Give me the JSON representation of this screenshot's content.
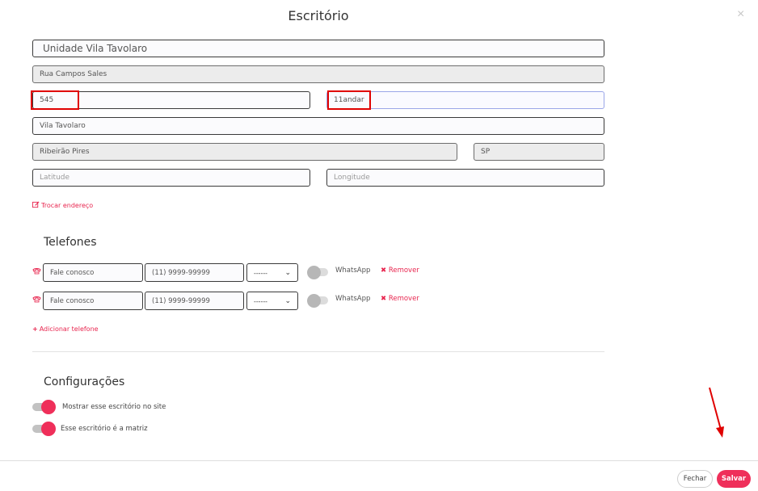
{
  "modal": {
    "title": "Escritório",
    "close_symbol": "×"
  },
  "address": {
    "name": "Unidade Vila Tavolaro",
    "street": "Rua Campos Sales",
    "number": "545",
    "complement": "11andar",
    "neighborhood": "Vila Tavolaro",
    "city": "Ribeirão Pires",
    "state": "SP",
    "latitude_placeholder": "Latitude",
    "longitude_placeholder": "Longitude",
    "change_address_label": "Trocar endereço"
  },
  "phones": {
    "section_title": "Telefones",
    "rows": [
      {
        "label": "Fale conosco",
        "number": "(11) 9999-99999",
        "type": "------",
        "whatsapp_label": "WhatsApp",
        "remove_label": "Remover"
      },
      {
        "label": "Fale conosco",
        "number": "(11) 9999-99999",
        "type": "------",
        "whatsapp_label": "WhatsApp",
        "remove_label": "Remover"
      }
    ],
    "add_label": "Adicionar telefone"
  },
  "settings": {
    "section_title": "Configurações",
    "show_on_site_label": "Mostrar esse escritório no site",
    "is_main_label": "Esse escritório é a matriz",
    "show_on_site": true,
    "is_main": true
  },
  "footer": {
    "close_label": "Fechar",
    "save_label": "Salvar"
  },
  "colors": {
    "accent": "#ef2f5a",
    "annotation": "#e00000"
  }
}
